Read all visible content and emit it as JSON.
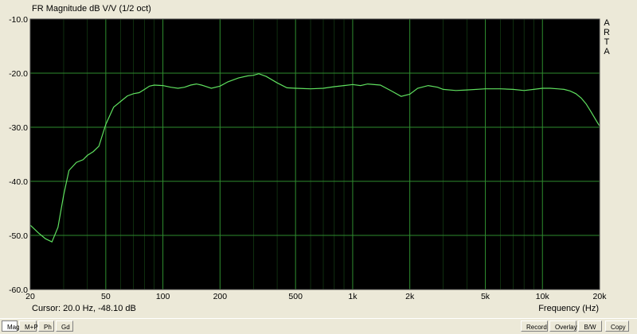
{
  "window": {
    "chart_title": "FR Magnitude dB V/V (1/2 oct)",
    "brand_vertical": "ARTA",
    "cursor_readout": "Cursor: 20.0 Hz, -48.10 dB",
    "freq_axis_label": "Frequency (Hz)"
  },
  "tabs": [
    {
      "label": "Mag",
      "active": true
    },
    {
      "label": "M+P",
      "active": false
    },
    {
      "label": "Ph",
      "active": false
    },
    {
      "label": "Gd",
      "active": false
    }
  ],
  "actions": [
    {
      "label": "Record"
    },
    {
      "label": "Overlay"
    },
    {
      "label": "B/W"
    },
    {
      "label": "Copy"
    }
  ],
  "colors": {
    "plot_bg": "#000000",
    "grid": "#2e8b2e",
    "trace": "#5fe05f",
    "frame": "#ece9d8"
  },
  "chart_data": {
    "type": "line",
    "title": "FR Magnitude dB V/V (1/2 oct)",
    "xlabel": "Frequency (Hz)",
    "ylabel": "",
    "xscale": "log",
    "xlim": [
      20,
      20000
    ],
    "ylim": [
      -60,
      -10
    ],
    "grid": true,
    "x_ticks": [
      {
        "value": 20,
        "label": "20"
      },
      {
        "value": 50,
        "label": "50"
      },
      {
        "value": 100,
        "label": "100"
      },
      {
        "value": 200,
        "label": "200"
      },
      {
        "value": 500,
        "label": "500"
      },
      {
        "value": 1000,
        "label": "1k"
      },
      {
        "value": 2000,
        "label": "2k"
      },
      {
        "value": 5000,
        "label": "5k"
      },
      {
        "value": 10000,
        "label": "10k"
      },
      {
        "value": 20000,
        "label": "20k"
      }
    ],
    "y_ticks": [
      {
        "value": -10,
        "label": "-10.0"
      },
      {
        "value": -20,
        "label": "-20.0"
      },
      {
        "value": -30,
        "label": "-30.0"
      },
      {
        "value": -40,
        "label": "-40.0"
      },
      {
        "value": -50,
        "label": "-50.0"
      },
      {
        "value": -60,
        "label": "-60.0"
      }
    ],
    "series": [
      {
        "x": [
          20,
          22,
          24,
          26,
          28,
          30,
          32,
          35,
          38,
          40,
          43,
          46,
          50,
          55,
          60,
          65,
          70,
          75,
          80,
          85,
          90,
          100,
          110,
          120,
          130,
          140,
          150,
          160,
          180,
          200,
          220,
          250,
          280,
          300,
          320,
          350,
          400,
          450,
          500,
          600,
          700,
          800,
          900,
          1000,
          1100,
          1200,
          1400,
          1600,
          1800,
          2000,
          2200,
          2500,
          2800,
          3000,
          3500,
          4000,
          5000,
          6000,
          7000,
          8000,
          9000,
          10000,
          11000,
          12000,
          13000,
          14000,
          15000,
          16000,
          17000,
          18000,
          19000,
          20000
        ],
        "y": [
          -48.1,
          -49.5,
          -50.6,
          -51.2,
          -48.5,
          -42.5,
          -38.0,
          -36.5,
          -36.0,
          -35.2,
          -34.5,
          -33.5,
          -29.5,
          -26.3,
          -25.2,
          -24.2,
          -23.8,
          -23.6,
          -23.0,
          -22.4,
          -22.2,
          -22.3,
          -22.6,
          -22.8,
          -22.6,
          -22.2,
          -22.0,
          -22.2,
          -22.8,
          -22.4,
          -21.6,
          -20.9,
          -20.5,
          -20.4,
          -20.1,
          -20.6,
          -21.8,
          -22.7,
          -22.8,
          -22.9,
          -22.8,
          -22.5,
          -22.3,
          -22.1,
          -22.3,
          -22.0,
          -22.2,
          -23.3,
          -24.3,
          -23.9,
          -22.8,
          -22.3,
          -22.6,
          -23.0,
          -23.2,
          -23.1,
          -22.9,
          -22.9,
          -23.0,
          -23.2,
          -23.0,
          -22.8,
          -22.8,
          -22.9,
          -23.0,
          -23.3,
          -23.8,
          -24.6,
          -25.7,
          -27.1,
          -28.5,
          -29.8
        ]
      }
    ]
  }
}
